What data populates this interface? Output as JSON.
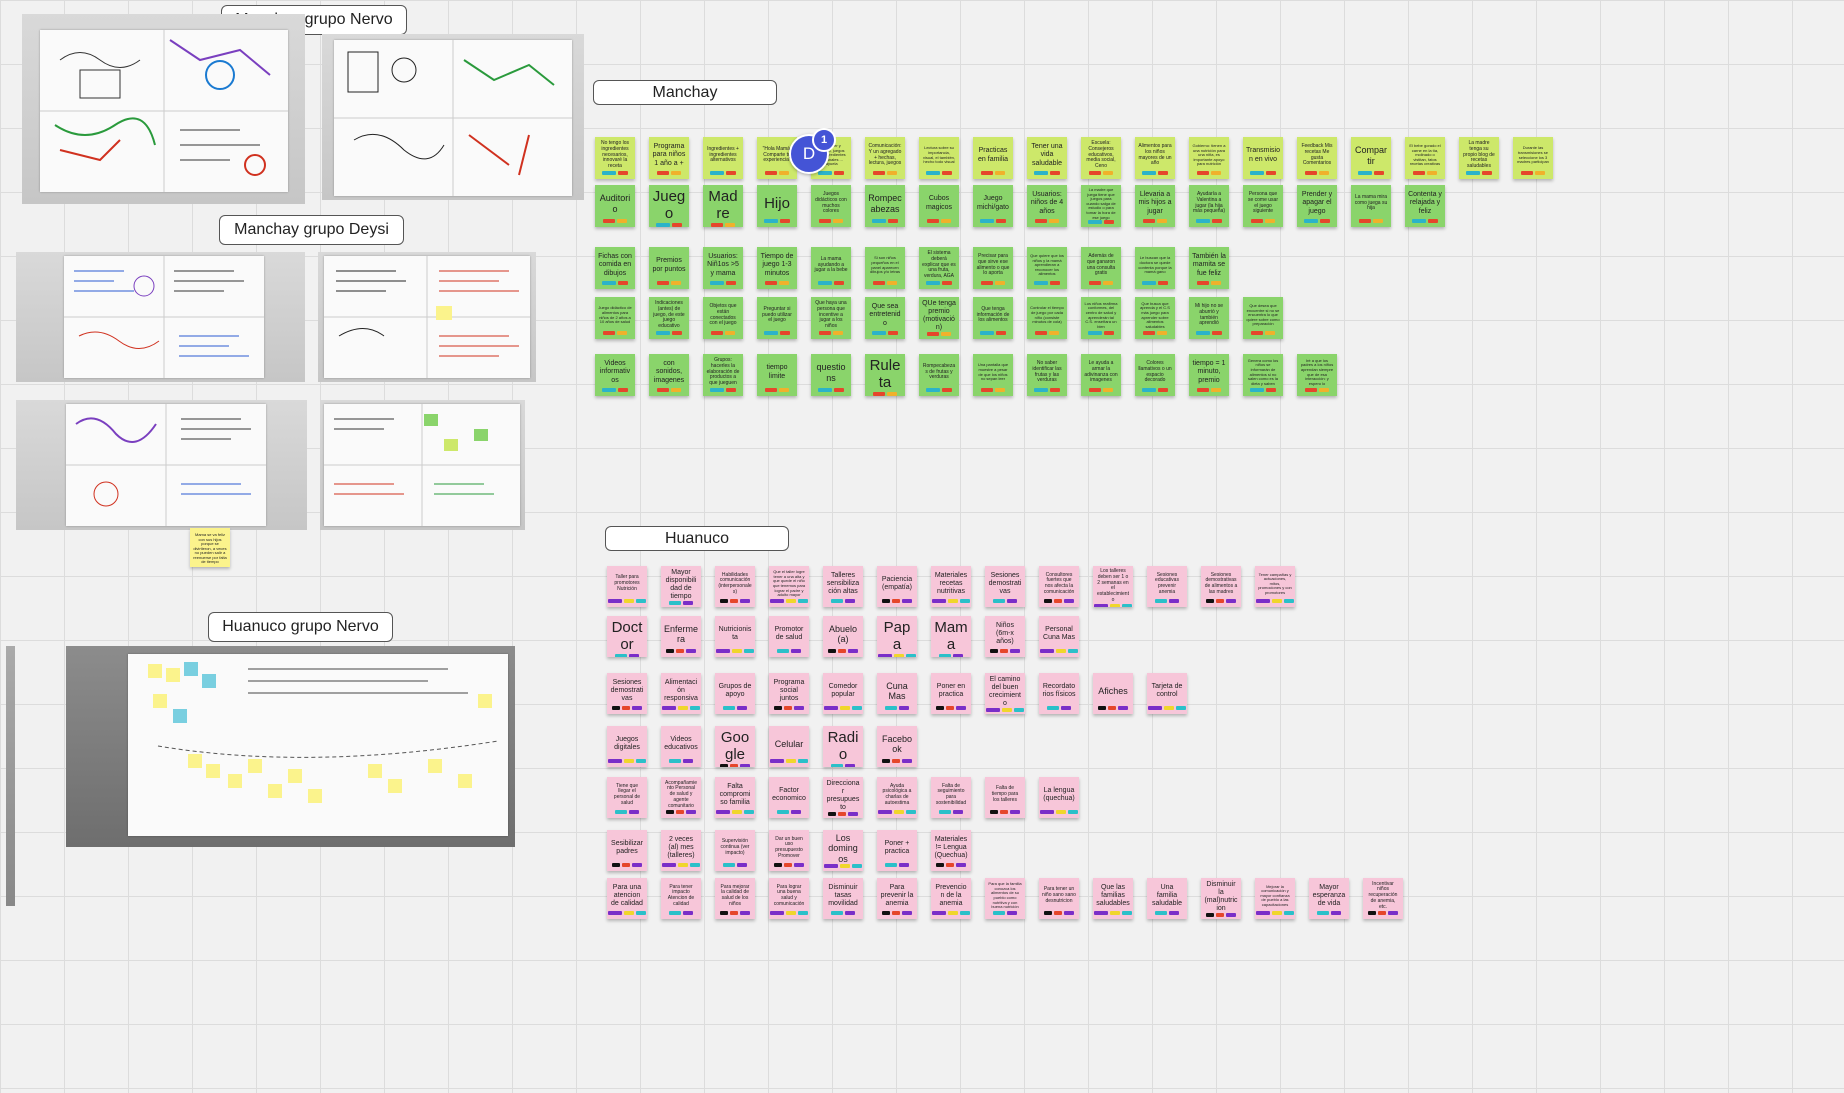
{
  "frames": {
    "manchay_nervo": "Manchay grupo Nervo",
    "manchay_deysi": "Manchay grupo Deysi",
    "huanuco_nervo": "Huanuco grupo Nervo",
    "manchay": "Manchay",
    "huanuco": "Huanuco"
  },
  "colors": {
    "green_note": "#8ad46b",
    "lime_note": "#cde86a",
    "pink_note": "#f7c6d9",
    "yellow_note": "#fbf38c",
    "avatar": "#4454d6"
  },
  "collaborator": {
    "initial": "D",
    "badge": "1"
  },
  "left_sticky": "Mama se va feliz con sus hijos porque se divirtieron, a veces no pueden salir a reenuerse por falta de tiempo",
  "manchay_rows": [
    [
      "No tengo los ingredientes necesarios, innovaré la receta",
      "Programa para niños 1 año a +",
      "Ingredientes + ingredientes alternativos",
      "\"Hola Mamá, Comparte tu experiencia\"",
      "Aprender y ensaño, juegos con ingredientes semanales ... rayuela",
      "Comunicación: Y un agregado + hechas, lectura, juegos",
      "Lectura sobre su importancia, visual, el también, hecho todo visual",
      "Practicas en familia",
      "Tener una vida saludable",
      "Escuela: Consejeros educativos, media social, Ceno",
      "Alimentos para los niños mayores de un año",
      "Gobierno: tienen a una nutrición para una niña, es importante apoyo para nutrición",
      "Transmision en vivo",
      "Feedback Mis recetas Me gusta Comentarios",
      "Compartir",
      "El bebe gorado el carne en la tía, molinado o vistitan, fatos recetas creativas",
      "La madre tenga su propio blog de recetas saludables",
      "Durante las transmisiones se seleccione los 3 madres participan"
    ],
    [
      "Auditorio",
      "Juego",
      "Madre",
      "Hijo",
      "Juegos didácticos con muchos colores",
      "Rompecabezas",
      "Cubos magicos",
      "Juego michi/gato",
      "Usuarios: niños de 4 años",
      "La madre que juega tiene que juegos para cuando salga de estudio o para tomar la hora de ese juego",
      "Llevaria a mis hijos a jugar",
      "Ayudaría a Valentina a jugar (la hija más pequeña)",
      "Persona que se come usar el juego siguiente",
      "Prender y apagar el juego",
      "La mama mira como juega su hija",
      "Contenta y relajada y feliz"
    ],
    [
      "Fichas con comida en dibujos",
      "Premios por puntos",
      "Usuarios: Niñ1os >5 y mama",
      "Tiempo de juego 1-3 minutos",
      "La mama ayudando a jugar a la bebe",
      "Si son niños pequeños en el panel aparecen dibujos y/o letras",
      "El sistema deberá explicar que es una fruta, verdura, AGA",
      "Precisar para que sirve ese alimento o que lo aporta",
      "Que quiere que los niños y la mamá aprendieran a reconocer los alimentos",
      "Además de que ganaron una consulta gratis",
      "Le buscan que la doctora se quede contenta porque la mamá gano",
      "También la mamita se fue feliz"
    ],
    [
      "Juego didáctico de alimentos para niños de 2 años a 10 años de salud",
      "Indicaciones (antes) de juego, de este juego educativo",
      "Objetos que están conectados con el juego",
      "Preguntar si puedo utilizar el juego",
      "Que haya una persona que incentive a jugar a los niños",
      "Que sea entretenido",
      "QUe tenga premio (motivación)",
      "Que tenga información de los alimentos",
      "Controlar el tiempo de juego por cada niño (consiste minutos de cola)",
      "Los niños reafirma conformes, del centro de salud y aprenderán tal C.S. enseñara un bien",
      "Que busca que aprenda y el C.S más juego para aprender sobre alimentos saludables",
      "Mi hijo no se aburrió y también aprendió",
      "Que desea que encuentre si no se encuentra lo que quiere sobre como preparación"
    ],
    [
      "Videos informativos",
      "con sonidos, imagenes",
      "Grupos: hacerles la elaboración de productos a que jueguen",
      "tiempo limite",
      "questions",
      "Ruleta",
      "Rompecabezas de frutas y verduras",
      "Una pantalla que muestre a pesar de que los niños no sepan leer",
      "No saber identificar las frutas y las verduras",
      "Le ayuda a armar la adivinanza con imagenes",
      "Colores llamativos o un espacio decorado",
      "tiempo = 1 minuto, premio",
      "Genera como los niños se informarán de alimentos si no salen como es la dieta y saben",
      "Iré a que los padres a los niños aprendan siempre que de esa interacción: y espero lo"
    ]
  ],
  "huanuco_rows": [
    [
      "Taller para promotores Nutrición",
      "Mayor disponibilidad de tiempo",
      "Habilidades comunicación (interpersonales)",
      "Que el taller logre tener a una alta y que quede el niño que tenemos para lograr el padre y adulto mayor",
      "Talleres sensibilización altas",
      "Paciencia (empatía)",
      "Materiales recetas nutritivas",
      "Sesiones demostrativas",
      "Consultores fuertes que nos afecta la comunicación",
      "Los talleres deben ser 1 o 2 semanas en el establecimiento",
      "Sesiones educativas prevenir anemia",
      "Sesiones demostrativas de alimentos a las madres",
      "Tener campañas y actuaciones, mitos, promociones y con promotores"
    ],
    [
      "Doctor",
      "Enfermera",
      "Nutricionista",
      "Promotor de salud",
      "Abuelo (a)",
      "Papa",
      "Mama",
      "Niños (6m-x años)",
      "Personal Cuna Mas"
    ],
    [
      "Sesiones demostrativas",
      "Alimentación responsiva",
      "Grupos de apoyo",
      "Programa social juntos",
      "Comedor popular",
      "Cuna Mas",
      "Poner en practica",
      "El camino del buen crecimiento",
      "Recordatorios físicos",
      "Afiches",
      "Tarjeta de control"
    ],
    [
      "Juegos digitales",
      "Videos educativos",
      "Google",
      "Celular",
      "Radio",
      "Facebook"
    ],
    [
      "Tiene que llegar el personal de salud",
      "Acompañamiento Personal de salud y agente comunitario",
      "Falta compromiso familia",
      "Factor economico",
      "Direccionar presupuesto",
      "Ayuda psicológica a charlas de autoestima",
      "Falta de seguimiento para sostenibilidad",
      "Falta de tiempo para los talleres",
      "La lengua (quechua)"
    ],
    [
      "Sesibilizar padres",
      "2 veces (al) mes (talleres)",
      "Supervisión continua (ver impacto)",
      "Dar un buen uso presupuesto Promover",
      "Los domingos",
      "Poner + practica",
      "Materiales != Lengua (Quechua)"
    ],
    [
      "Para una atencion de calidad",
      "Para tener impacto Atencion de calidad",
      "Para mejorar la calidad de salud de los niños",
      "Para lograr una buena salud y comunicación",
      "Disminuir tasas movilidad",
      "Para prevenir la anemia",
      "Prevencion de la anemia",
      "Para que la familia conozca los alimentos de su pueblo como nutritiva y con buena nutrición",
      "Para tener un niño sano sano desnutricion",
      "Que las familias saludables",
      "Una familia saludable",
      "Disminuir la (mal)nutricion",
      "Mejorar la comunicación y mayor confianza de pueblo a las capacitaciones",
      "Mayor esperanza de vida",
      "Incentivar niños recuperación de anemia, etc."
    ]
  ]
}
